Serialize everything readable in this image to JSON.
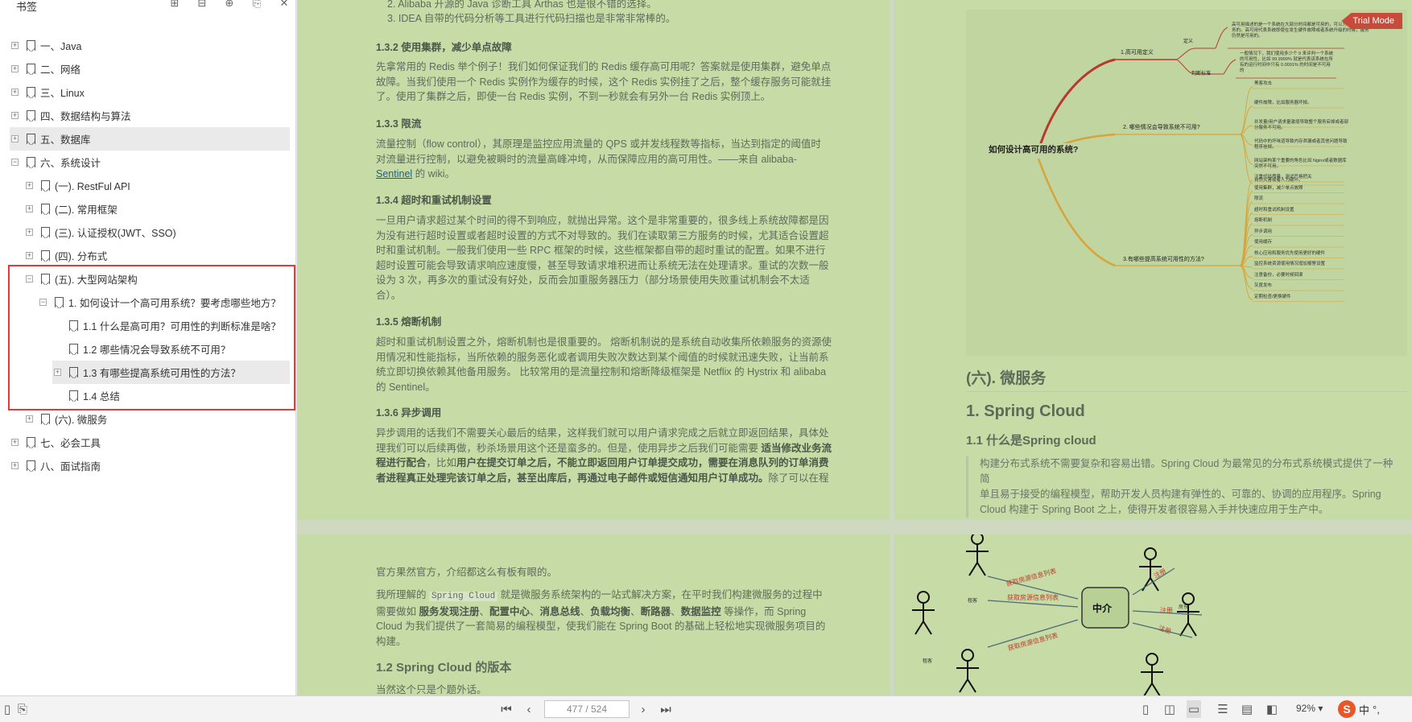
{
  "sidebar": {
    "title": "书签",
    "items": [
      {
        "label": "一、Java",
        "level": 0,
        "expander": "+"
      },
      {
        "label": "二、网络",
        "level": 0,
        "expander": "+"
      },
      {
        "label": "三、Linux",
        "level": 0,
        "expander": "+"
      },
      {
        "label": "四、数据结构与算法",
        "level": 0,
        "expander": "+"
      },
      {
        "label": "五、数据库",
        "level": 0,
        "expander": "+",
        "highlighted": true
      },
      {
        "label": "六、系统设计",
        "level": 0,
        "expander": "−"
      },
      {
        "label": "(一). RestFul API",
        "level": 1,
        "expander": "+"
      },
      {
        "label": "(二). 常用框架",
        "level": 1,
        "expander": "+"
      },
      {
        "label": "(三). 认证授权(JWT、SSO)",
        "level": 1,
        "expander": "+"
      },
      {
        "label": "(四). 分布式",
        "level": 1,
        "expander": "+"
      },
      {
        "label": "(五). 大型网站架构",
        "level": 1,
        "expander": "−"
      },
      {
        "label": "1. 如何设计一个高可用系统？要考虑哪些地方？",
        "level": 2,
        "expander": "−"
      },
      {
        "label": "1.1 什么是高可用？可用性的判断标准是啥？",
        "level": 3,
        "expander": ""
      },
      {
        "label": "1.2 哪些情况会导致系统不可用？",
        "level": 3,
        "expander": ""
      },
      {
        "label": "1.3 有哪些提高系统可用性的方法？",
        "level": 3,
        "expander": "+",
        "highlighted": true
      },
      {
        "label": "1.4 总结",
        "level": 3,
        "expander": ""
      },
      {
        "label": "(六). 微服务",
        "level": 1,
        "expander": "+"
      },
      {
        "label": "七、必会工具",
        "level": 0,
        "expander": "+"
      },
      {
        "label": "八、面试指南",
        "level": 0,
        "expander": "+"
      }
    ]
  },
  "page1": {
    "list2": "2. Alibaba 开源的 Java 诊断工具 Arthas 也是很不错的选择。",
    "list3": "3. IDEA 自带的代码分析等工具进行代码扫描也是非常非常棒的。",
    "h132": "1.3.2 使用集群，减少单点故障",
    "p132": [
      "先拿常用的 Redis 举个例子！我们如何保证我们的 Redis 缓存高可用呢？答案就是使用集群，避免单点",
      "故障。当我们使用一个 Redis 实例作为缓存的时候，这个 Redis 实例挂了之后，整个缓存服务可能就挂",
      "了。使用了集群之后，即使一台 Redis 实例，不到一秒就会有另外一台 Redis 实例顶上。"
    ],
    "h133": "1.3.3 限流",
    "p133a": [
      "流量控制（flow control），其原理是监控应用流量的 QPS 或并发线程数等指标，当达到指定的阈值时",
      "对流量进行控制，以避免被瞬时的流量高峰冲垮，从而保障应用的高可用性。——来自 alibaba-"
    ],
    "p133_link": "Sentinel",
    "p133_tail": " 的 wiki。",
    "h134": "1.3.4 超时和重试机制设置",
    "p134": [
      "一旦用户请求超过某个时间的得不到响应，就抛出异常。这个是非常重要的，很多线上系统故障都是因",
      "为没有进行超时设置或者超时设置的方式不对导致的。我们在读取第三方服务的时候，尤其适合设置超",
      "时和重试机制。一般我们使用一些 RPC 框架的时候，这些框架都自带的超时重试的配置。如果不进行",
      "超时设置可能会导致请求响应速度慢，甚至导致请求堆积进而让系统无法在处理请求。重试的次数一般",
      "设为 3 次，再多次的重试没有好处，反而会加重服务器压力（部分场景使用失败重试机制会不太适",
      "合）。"
    ],
    "h135": "1.3.5 熔断机制",
    "p135": [
      "超时和重试机制设置之外，熔断机制也是很重要的。 熔断机制说的是系统自动收集所依赖服务的资源使",
      "用情况和性能指标，当所依赖的服务恶化或者调用失败次数达到某个阈值的时候就迅速失败，让当前系",
      "统立即切换依赖其他备用服务。 比较常用的是流量控制和熔断降级框架是 Netflix 的 Hystrix 和 alibaba",
      "的 Sentinel。"
    ],
    "h136": "1.3.6 异步调用",
    "p136_l1": "异步调用的话我们不需要关心最后的结果，这样我们就可以用户请求完成之后就立即返回结果，具体处",
    "p136_l2a": "理我们可以后续再做，秒杀场景用这个还是蛮多的。但是，使用异步之后我们可能需要 ",
    "p136_l2b": "适当修改业务流",
    "p136_l3a": "程进行配合",
    "p136_l3b": "，比如",
    "p136_l3c": "用户在提交订单之后，不能立即返回用户订单提交成功，需要在消息队列的订单消费",
    "p136_l4a": "者进程真正处理完该订单之后，甚至出库后，再通过电子邮件或短信通知用户订单成功。",
    "p136_l4b": "除了可以在程"
  },
  "mindmap": {
    "trial": "Trial Mode",
    "root": "如何设计高可用的系统?",
    "b1": "1.高可用定义",
    "b1_def": "定义",
    "b1_def_text": [
      "高可用描述的是一个系统在大部分时间都是可用的，可以为我们提供服",
      "务的。高可用代表系统即使在发生硬件故障或者系统升级的时候，服务",
      "仍然是可用的。"
    ],
    "b1_judge": "判断标准",
    "b1_judge_text": [
      "一般情况下，我们使用多少个 9 来评判一个系统",
      "的可用性，比如 99.9999% 就是代表该系统在所",
      "有的运行时间中只有 0.0001% 的时间是不可用",
      "的"
    ],
    "b2": "2. 哪些情况会导致系统不可用?",
    "b2_items": [
      "黑客攻击",
      "硬件故障，比如服务器坏掉。",
      "并发量/用户请求量激增导致整个服务宕掉或者部\n分服务不可用。",
      "代码中的坏味道导致内存泄漏或者其他问题导致\n程序挂掉。",
      "网站架构某个重要的角色比如 Nginx或者数据库\n突然不可用。",
      "自然灾害或者人为破坏。"
    ],
    "b3": "3.有哪些提高系统可用性的方法?",
    "b3_items": [
      "注重代码质量，测试严格把关",
      "使用集群，减少单点故障",
      "限流",
      "超时和重试机制设置",
      "熔断机制",
      "异步调用",
      "使用缓存",
      "核心应用和服务优先使用更好的硬件",
      "监控系统资源使用情况增加报警设置",
      "注意备份，必要时候回滚",
      "灰度发布",
      "定期检查/更换硬件"
    ]
  },
  "page2": {
    "sec_title": "(六). 微服务",
    "h1": "1. Spring Cloud",
    "h11": "1.1 什么是Spring cloud",
    "quote": [
      "构建分布式系统不需要复杂和容易出错。Spring Cloud 为最常见的分布式系统模式提供了一种简",
      "单且易于接受的编程模型，帮助开发人员构建有弹性的、可靠的、协调的应用程序。Spring",
      "Cloud 构建于 Spring Boot 之上，使得开发者很容易入手并快速应用于生产中。"
    ]
  },
  "page3": {
    "p1": "官方果然官方，介绍都这么有板有眼的。",
    "p2a": "我所理解的 ",
    "p2_code": "Spring Cloud",
    "p2b": " 就是微服务系统架构的一站式解决方案，在平时我们构建微服务的过程中",
    "p3a": "需要做如 ",
    "p3_items": [
      "服务发现注册",
      "配置中心",
      "消息总线",
      "负载均衡",
      "断路器",
      "数据监控"
    ],
    "p3b": " 等操作，而 Spring",
    "p4": "Cloud 为我们提供了一套简易的编程模型，使我们能在 Spring Boot 的基础上轻松地实现微服务项目的",
    "p5": "构建。",
    "h12": "1.2 Spring Cloud 的版本",
    "p6": "当然这个只是个题外话。"
  },
  "diagram": {
    "center": "中介",
    "buyer": "租客",
    "seller": "房东",
    "arrow_get": "获取房源信息列表",
    "arrow_reg": "注册"
  },
  "bottombar": {
    "page": "477 / 524",
    "zoom": "92%",
    "ime_lang": "中",
    "ime_extra": "°,"
  }
}
